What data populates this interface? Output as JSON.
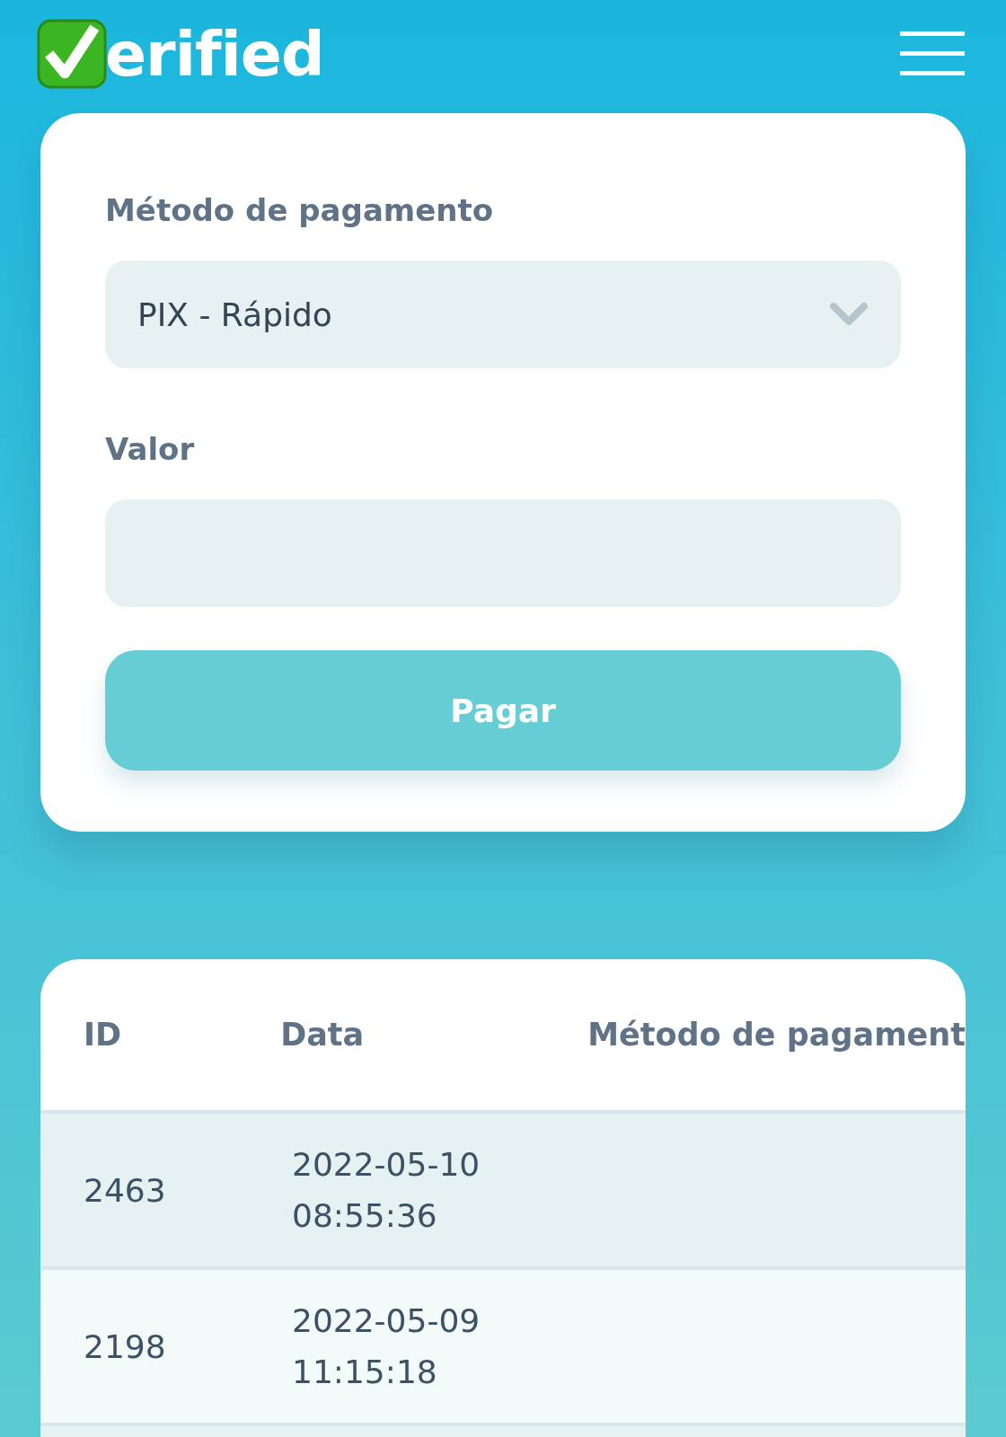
{
  "header": {
    "logo_text": "erified"
  },
  "payment_form": {
    "method_label": "Método de pagamento",
    "method_value": "PIX - Rápido",
    "amount_label": "Valor",
    "submit_button": "Pagar"
  },
  "table": {
    "columns": [
      "ID",
      "Data",
      "Método de pagament"
    ],
    "rows": [
      {
        "id": "2463",
        "date": "2022-05-10",
        "time": "08:55:36"
      },
      {
        "id": "2198",
        "date": "2022-05-09",
        "time": "11:15:18"
      }
    ]
  }
}
